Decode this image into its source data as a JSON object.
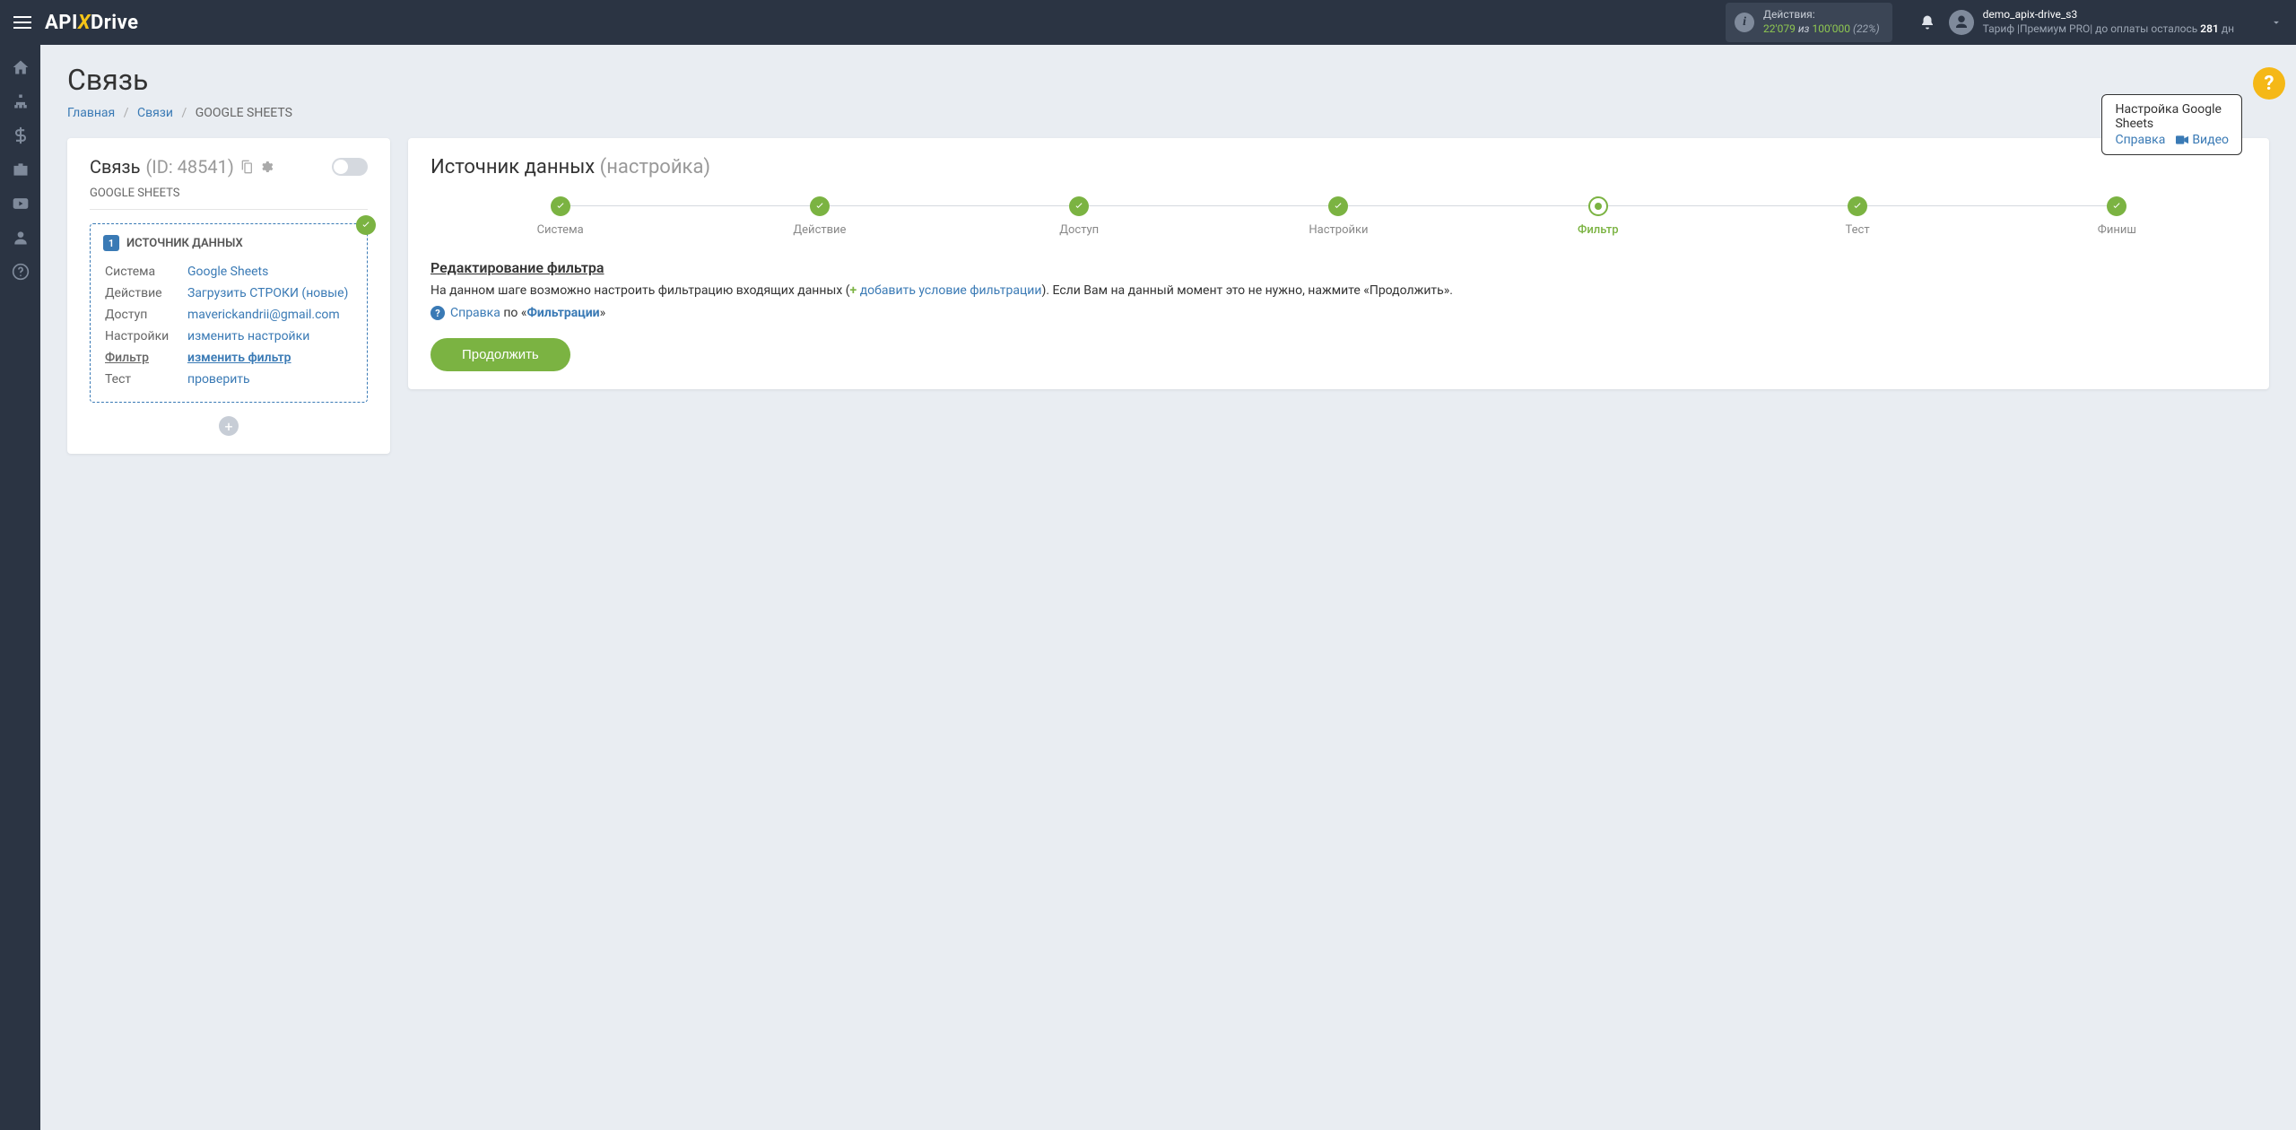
{
  "header": {
    "logo_pre": "API",
    "logo_x": "X",
    "logo_post": "Drive",
    "actions_label": "Действия:",
    "actions_used": "22'079",
    "actions_of": "из",
    "actions_total": "100'000",
    "actions_pct": "(22%)",
    "user_name": "demo_apix-drive_s3",
    "tariff_pre": "Тариф |Премиум PRO| до оплаты осталось ",
    "tariff_days": "281",
    "tariff_post": " дн"
  },
  "page": {
    "title": "Связь",
    "bc_home": "Главная",
    "bc_links": "Связи",
    "bc_current": "GOOGLE SHEETS"
  },
  "help": {
    "title": "Настройка Google Sheets",
    "ref": "Справка",
    "video": "Видео",
    "q": "?"
  },
  "left": {
    "title": "Связь",
    "id": "(ID: 48541)",
    "sub": "GOOGLE SHEETS",
    "badge": "1",
    "src_title": "ИСТОЧНИК ДАННЫХ",
    "rows": [
      {
        "k": "Система",
        "v": "Google Sheets"
      },
      {
        "k": "Действие",
        "v": "Загрузить СТРОКИ (новые)"
      },
      {
        "k": "Доступ",
        "v": "maverickandrii@gmail.com"
      },
      {
        "k": "Настройки",
        "v": "изменить настройки"
      },
      {
        "k": "Фильтр",
        "v": "изменить фильтр"
      },
      {
        "k": "Тест",
        "v": "проверить"
      }
    ]
  },
  "right": {
    "title": "Источник данных",
    "title_sub": "(настройка)",
    "steps": [
      "Система",
      "Действие",
      "Доступ",
      "Настройки",
      "Фильтр",
      "Тест",
      "Финиш"
    ],
    "section": "Редактирование фильтра",
    "desc_1": "На данном шаге возможно настроить фильтрацию входящих данных (",
    "desc_plus": "+",
    "desc_link": " добавить условие фильтрации",
    "desc_2": "). Если Вам на данный момент это не нужно, нажмите «Продолжить».",
    "help_ref": "Справка",
    "help_on": " по «",
    "help_topic": "Фильтрации",
    "help_close": "»",
    "btn": "Продолжить"
  }
}
